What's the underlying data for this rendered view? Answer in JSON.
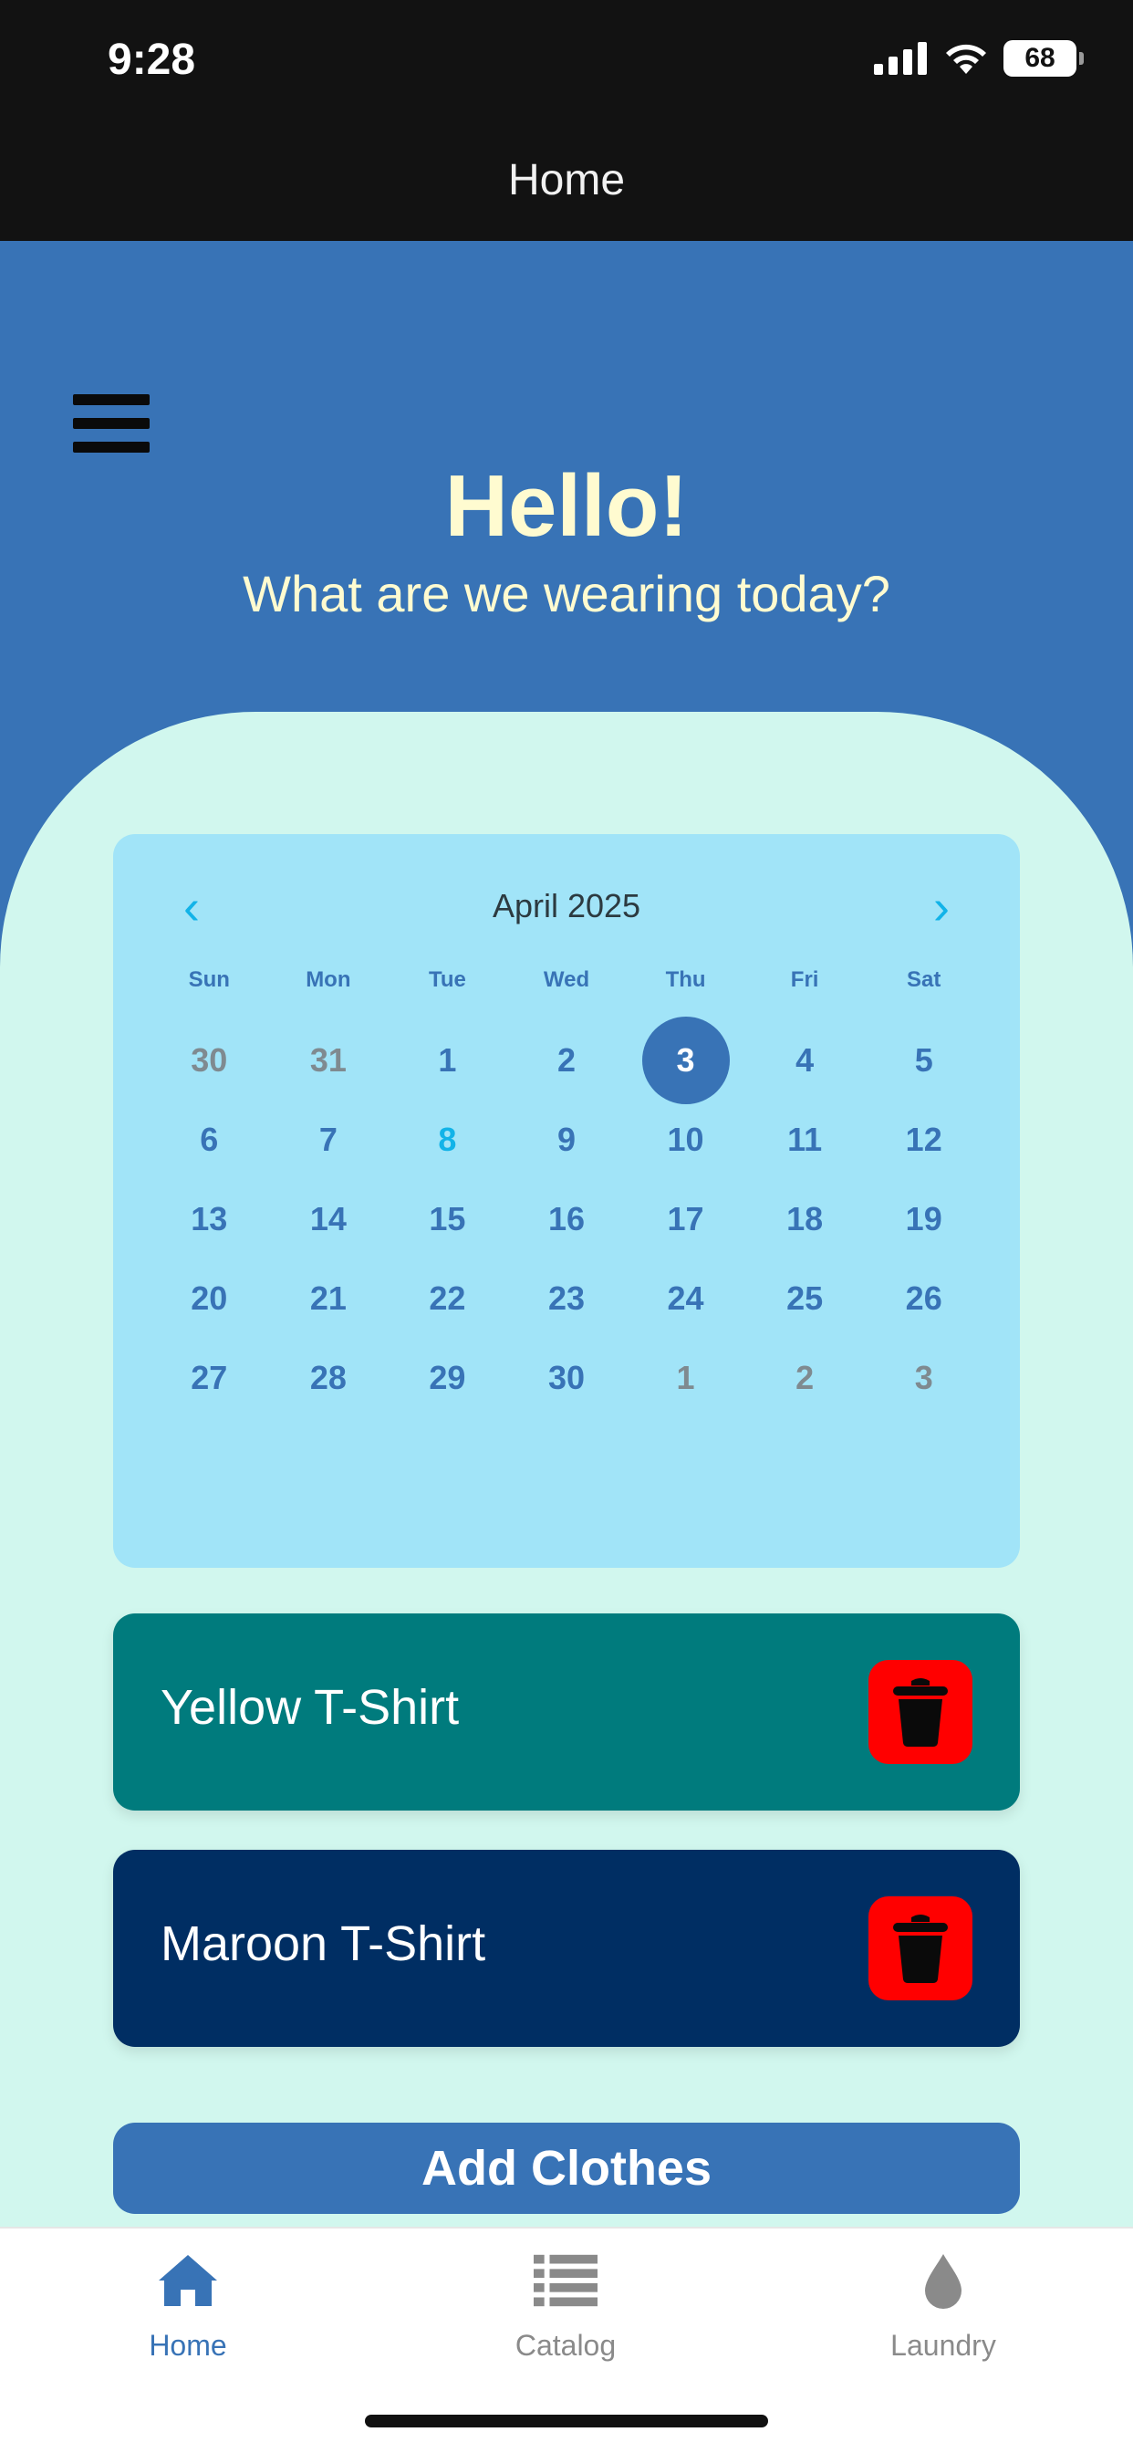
{
  "status": {
    "time": "9:28",
    "battery": "68"
  },
  "header": {
    "title": "Home"
  },
  "hero": {
    "greeting": "Hello!",
    "subtitle": "What are we wearing today?"
  },
  "calendar": {
    "month": "April 2025",
    "weekdays": [
      "Sun",
      "Mon",
      "Tue",
      "Wed",
      "Thu",
      "Fri",
      "Sat"
    ],
    "days": [
      {
        "d": "30",
        "s": "muted"
      },
      {
        "d": "31",
        "s": "muted"
      },
      {
        "d": "1",
        "s": ""
      },
      {
        "d": "2",
        "s": ""
      },
      {
        "d": "3",
        "s": "selected"
      },
      {
        "d": "4",
        "s": ""
      },
      {
        "d": "5",
        "s": ""
      },
      {
        "d": "6",
        "s": ""
      },
      {
        "d": "7",
        "s": ""
      },
      {
        "d": "8",
        "s": "today"
      },
      {
        "d": "9",
        "s": ""
      },
      {
        "d": "10",
        "s": ""
      },
      {
        "d": "11",
        "s": ""
      },
      {
        "d": "12",
        "s": ""
      },
      {
        "d": "13",
        "s": ""
      },
      {
        "d": "14",
        "s": ""
      },
      {
        "d": "15",
        "s": ""
      },
      {
        "d": "16",
        "s": ""
      },
      {
        "d": "17",
        "s": ""
      },
      {
        "d": "18",
        "s": ""
      },
      {
        "d": "19",
        "s": ""
      },
      {
        "d": "20",
        "s": ""
      },
      {
        "d": "21",
        "s": ""
      },
      {
        "d": "22",
        "s": ""
      },
      {
        "d": "23",
        "s": ""
      },
      {
        "d": "24",
        "s": ""
      },
      {
        "d": "25",
        "s": ""
      },
      {
        "d": "26",
        "s": ""
      },
      {
        "d": "27",
        "s": ""
      },
      {
        "d": "28",
        "s": ""
      },
      {
        "d": "29",
        "s": ""
      },
      {
        "d": "30",
        "s": ""
      },
      {
        "d": "1",
        "s": "muted"
      },
      {
        "d": "2",
        "s": "muted"
      },
      {
        "d": "3",
        "s": "muted"
      }
    ]
  },
  "items": [
    {
      "label": "Yellow T-Shirt",
      "color": "#007b7d"
    },
    {
      "label": "Maroon T-Shirt",
      "color": "#002e63"
    }
  ],
  "actions": {
    "add_label": "Add Clothes"
  },
  "tabs": [
    {
      "label": "Home",
      "icon": "home-icon",
      "active": true
    },
    {
      "label": "Catalog",
      "icon": "list-icon",
      "active": false
    },
    {
      "label": "Laundry",
      "icon": "droplet-icon",
      "active": false
    }
  ],
  "colors": {
    "accent": "#3873b6",
    "mint": "#d1f7ee",
    "calendar": "#a1e4f8",
    "delete": "#ff0000",
    "greeting": "#fffbd0"
  }
}
